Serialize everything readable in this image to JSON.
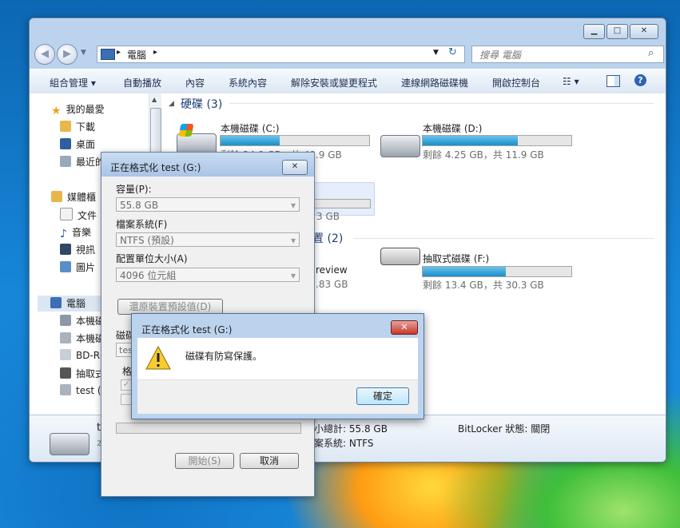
{
  "explorer": {
    "address": {
      "crumb": "電腦",
      "search_placeholder": "搜尋 電腦"
    },
    "toolbar": {
      "organize": "組合管理",
      "autoplay": "自動播放",
      "properties": "內容",
      "system_properties": "系統內容",
      "uninstall": "解除安裝或變更程式",
      "map_drive": "連線網路磁碟機",
      "control_panel": "開啟控制台"
    },
    "sidebar": {
      "favorites": "我的最愛",
      "downloads": "下載",
      "desktop": "桌面",
      "recent": "最近的",
      "libraries": "媒體櫃",
      "documents": "文件",
      "music": "音樂",
      "videos": "視訊",
      "pictures": "圖片",
      "computer": "電腦",
      "local_disk_c": "本機磁",
      "local_disk_d": "本機磁",
      "bd_rom": "BD-RO",
      "removable": "抽取式",
      "test": "test (G"
    },
    "groups": {
      "hdd": "硬碟 (3)",
      "removable": "置 (2)"
    },
    "drives": {
      "c_name": "本機磁碟 (C:)",
      "c_info": "剩餘 34.9 GB，共 49.9 GB",
      "c_fill": 0.4,
      "d_name": "本機磁碟 (D:)",
      "d_info": "剩餘 4.25 GB，共 11.9 GB",
      "d_fill": 0.64,
      "g_info": "3 GB",
      "bd_name": "review",
      "bd_info": ".83 GB",
      "f_name": "抽取式磁碟 (F:)",
      "f_info": "剩餘 13.4 GB，共 30.3 GB",
      "f_fill": 0.56
    },
    "details": {
      "name": "t",
      "sub": "本",
      "total": "小總計: 55.8 GB",
      "fs": "案系統: NTFS",
      "bitlocker": "BitLocker 狀態: 關閉"
    }
  },
  "format_dialog": {
    "title": "正在格式化 test (G:)",
    "capacity_label": "容量(P):",
    "capacity_value": "55.8 GB",
    "fs_label": "檔案系統(F)",
    "fs_value": "NTFS (預設)",
    "alloc_label": "配置單位大小(A)",
    "alloc_value": "4096 位元組",
    "restore_button": "還原裝置預設值(D)",
    "volume_label": "磁碟",
    "volume_value": "test",
    "options_label": "格",
    "start_button": "開始(S)",
    "cancel_button": "取消"
  },
  "message_box": {
    "title": "正在格式化 test (G:)",
    "text": "磁碟有防寫保護。",
    "ok_button": "確定"
  }
}
